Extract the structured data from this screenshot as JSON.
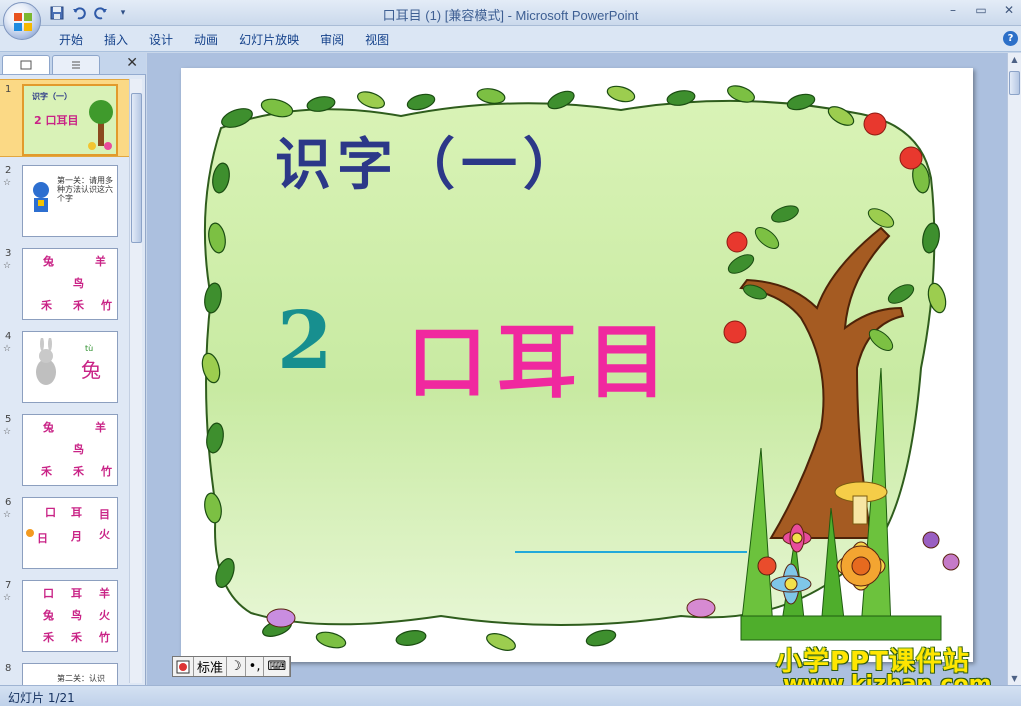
{
  "window": {
    "title_doc": "口耳目 (1) [兼容模式]",
    "title_sep": " - ",
    "title_app": "Microsoft PowerPoint",
    "controls": [
      "minimize-icon",
      "restore-icon",
      "close-icon"
    ]
  },
  "qat": {
    "icons": [
      "save-icon",
      "undo-icon",
      "redo-icon",
      "customize-icon"
    ]
  },
  "ribbon": {
    "tabs": [
      "开始",
      "插入",
      "设计",
      "动画",
      "幻灯片放映",
      "审阅",
      "视图"
    ],
    "help": "?"
  },
  "left_pane": {
    "close": "✕",
    "slides": [
      {
        "num": "1",
        "text": "识字（一）",
        "words": "2 口耳目"
      },
      {
        "num": "2",
        "text": "第一关：请用多种方法认识这六个字"
      },
      {
        "num": "3",
        "chars": [
          "兔",
          "羊",
          "鸟",
          "禾",
          "禾",
          "竹"
        ]
      },
      {
        "num": "4",
        "pinyin": "tù",
        "chars": [
          "兔"
        ]
      },
      {
        "num": "5",
        "chars": [
          "兔",
          "羊",
          "鸟",
          "禾",
          "禾",
          "竹"
        ]
      },
      {
        "num": "6",
        "chars": [
          "口",
          "耳",
          "目",
          "日",
          "月",
          "火"
        ]
      },
      {
        "num": "7",
        "chars": [
          "口",
          "耳",
          "羊",
          "兔",
          "鸟",
          "火",
          "禾",
          "禾",
          "竹"
        ]
      },
      {
        "num": "8",
        "text": "第二关：认识"
      }
    ]
  },
  "slide": {
    "title": "识字（一）",
    "lesson_number": "2",
    "lesson_words": "口耳目"
  },
  "ime_bar": {
    "mode": "标准",
    "moon": "☽",
    "punct": "•,",
    "keyboard": "⌨"
  },
  "watermark": {
    "line1": "小学PPT课件站",
    "line2": "www.kjzhan.com"
  },
  "status": {
    "text": "幻灯片 1/21"
  },
  "colors": {
    "title": "#2c3888",
    "number": "#178f8f",
    "words": "#f0289f",
    "frame_fill": "#d3f0b0"
  }
}
